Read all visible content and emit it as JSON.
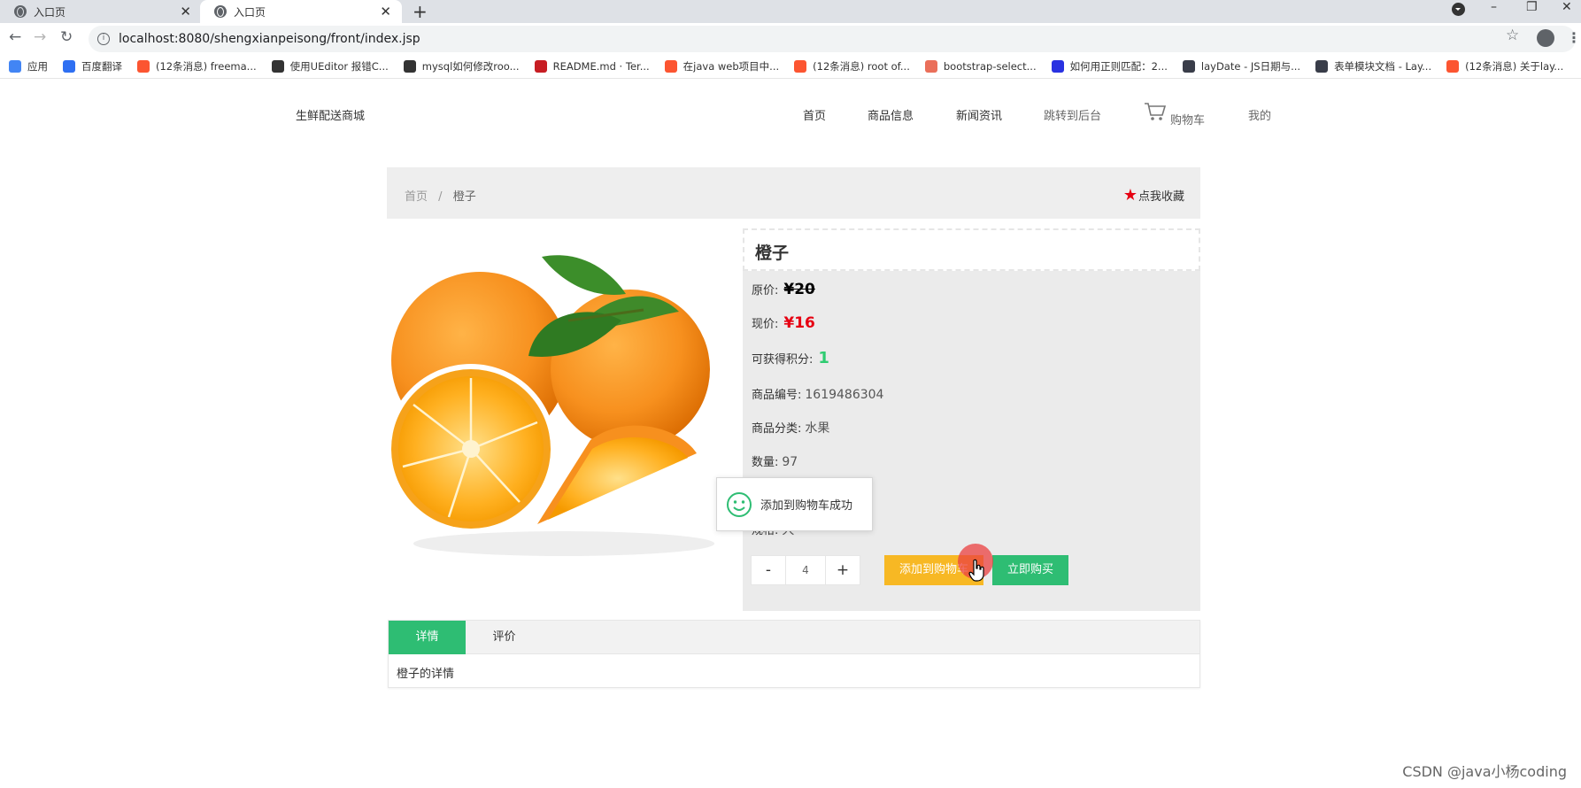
{
  "browser": {
    "tabs": [
      {
        "title": "入口页",
        "active": false
      },
      {
        "title": "入口页",
        "active": true
      }
    ],
    "url": "localhost:8080/shengxianpeisong/front/index.jsp",
    "bookmarks": [
      {
        "label": "应用",
        "icon": "apps-grid-icon",
        "color": "#4285f4"
      },
      {
        "label": "百度翻译",
        "icon": "baidu-translate-icon",
        "color": "#2e6ff2"
      },
      {
        "label": "(12条消息) freema...",
        "icon": "csdn-icon",
        "color": "#fc5531"
      },
      {
        "label": "使用UEditor 报错C...",
        "icon": "feather-icon",
        "color": "#333333"
      },
      {
        "label": "mysql如何修改roo...",
        "icon": "feather-icon",
        "color": "#333333"
      },
      {
        "label": "README.md · Ter...",
        "icon": "gitee-icon",
        "color": "#c71d23"
      },
      {
        "label": "在java web项目中...",
        "icon": "csdn-icon",
        "color": "#fc5531"
      },
      {
        "label": "(12条消息) root of...",
        "icon": "csdn-icon",
        "color": "#fc5531"
      },
      {
        "label": "bootstrap-select...",
        "icon": "jianshu-icon",
        "color": "#ea6f5a"
      },
      {
        "label": "如何用正则匹配：2...",
        "icon": "baidu-paw-icon",
        "color": "#2932e1"
      },
      {
        "label": "layDate - JS日期与...",
        "icon": "layui-icon",
        "color": "#393d49"
      },
      {
        "label": "表单模块文档 - Lay...",
        "icon": "layui-icon",
        "color": "#393d49"
      },
      {
        "label": "(12条消息) 关于lay...",
        "icon": "csdn-icon",
        "color": "#fc5531"
      }
    ]
  },
  "site": {
    "logo": "生鲜配送商城",
    "nav": {
      "home": "首页",
      "products": "商品信息",
      "news": "新闻资讯",
      "admin": "跳转到后台",
      "cart": "购物车",
      "mine": "我的"
    }
  },
  "breadcrumb": {
    "home": "首页",
    "separator": "/",
    "current": "橙子"
  },
  "favorite": "点我收藏",
  "product": {
    "name": "橙子",
    "original_price_label": "原价:",
    "original_price": "¥20",
    "current_price_label": "现价:",
    "current_price": "¥16",
    "points_label": "可获得积分:",
    "points": "1",
    "code_label": "商品编号:",
    "code": "1619486304",
    "category_label": "商品分类:",
    "category": "水果",
    "stock_label": "数量:",
    "stock": "97",
    "extra_label": "规格:",
    "extra_value": "大"
  },
  "purchase": {
    "minus": "-",
    "quantity": "4",
    "plus": "+",
    "add_to_cart": "添加到购物车",
    "buy_now": "立即购买"
  },
  "toast": {
    "message": "添加到购物车成功"
  },
  "detail_tabs": {
    "tabs": [
      "详情",
      "评价"
    ],
    "active": "详情",
    "content": "橙子的详情"
  },
  "watermark": "CSDN @java小杨coding",
  "colors": {
    "accent_green": "#2ebd73",
    "cart_yellow": "#f7b824",
    "price_red": "#e60012",
    "points_green": "#2ecc71"
  }
}
